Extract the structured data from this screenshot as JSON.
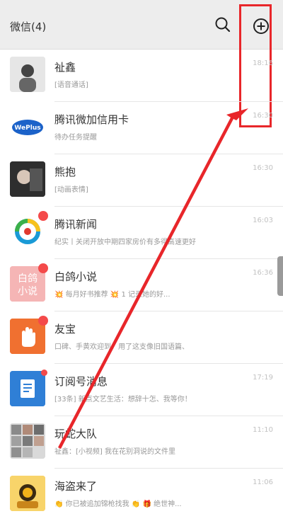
{
  "header": {
    "title": "微信(4)"
  },
  "colors": {
    "highlight": "#e8262a",
    "badge": "#f44a4a"
  },
  "icons": {
    "search": "search-icon",
    "add": "plus-circle-icon"
  },
  "chats": [
    {
      "name": "祉鑫",
      "preview": "[语音通话]",
      "time": "18:16",
      "avatar": "#dcdcdc"
    },
    {
      "name": "腾讯微加信用卡",
      "preview": "待办任务提醒",
      "time": "16:30",
      "avatar": "#ffffff"
    },
    {
      "name": "熊抱",
      "preview": "[动画表情]",
      "time": "16:30",
      "avatar": "#3a3a3a"
    },
    {
      "name": "腾讯新闻",
      "preview": "纪实丨关闭开放中期四家房价有多得高速更好",
      "time": "16:03",
      "avatar": "#ffffff",
      "badge": ""
    },
    {
      "name": "白鸽小说",
      "preview": "💥 每月好书推荐 💥   1 记录她的好...",
      "time": "16:36",
      "avatar": "#f0a0a0",
      "badge": ""
    },
    {
      "name": "友宝",
      "preview": "口碑、手黄欢迎到！用了这支像旧国语篇、",
      "time": "",
      "avatar": "#f07030",
      "badge": ""
    },
    {
      "name": "订阅号消息",
      "preview": "[33条] 新点文艺生活：想辞十怎、我等你！",
      "time": "17:19",
      "avatar": "#2f7fd6",
      "dot": true
    },
    {
      "name": "玩蛇大队",
      "preview": "祉鑫：[小视频] 我在花别洞说的文件里",
      "time": "11:10",
      "avatar": "#cfcfcf"
    },
    {
      "name": "海盗来了",
      "preview": "👏 你已被追加锦枪找我 👏   🎁 绝世神...",
      "time": "11:06",
      "avatar": "#f2b21a"
    }
  ]
}
